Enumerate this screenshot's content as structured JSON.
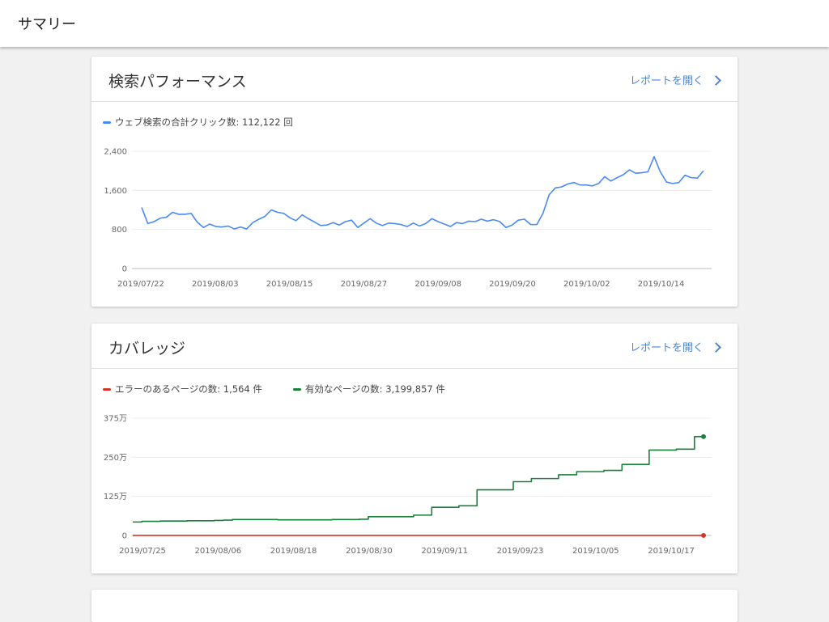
{
  "page": {
    "title": "サマリー"
  },
  "performance": {
    "title": "検索パフォーマンス",
    "report_link": "レポートを開く",
    "legend": [
      {
        "label": "ウェブ検索の合計クリック数: 112,122 回",
        "color": "#4a8af4"
      }
    ]
  },
  "coverage": {
    "title": "カバレッジ",
    "report_link": "レポートを開く",
    "legend": [
      {
        "label": "エラーのあるページの数: 1,564 件",
        "color": "#d93025"
      },
      {
        "label": "有効なページの数: 3,199,857 件",
        "color": "#188038"
      }
    ]
  },
  "chart_data": [
    {
      "type": "line",
      "ylim": [
        0,
        2400
      ],
      "yticks": [
        0,
        800,
        1600,
        2400
      ],
      "ytick_labels": [
        "0",
        "800",
        "1,600",
        "2,400"
      ],
      "xtick_labels": [
        "2019/07/22",
        "2019/08/03",
        "2019/08/15",
        "2019/08/27",
        "2019/09/08",
        "2019/09/20",
        "2019/10/02",
        "2019/10/14"
      ],
      "x_start": "2019/07/22",
      "series": [
        {
          "color": "#4a8af4",
          "values": [
            1250,
            920,
            960,
            1030,
            1050,
            1150,
            1110,
            1110,
            1130,
            950,
            840,
            910,
            860,
            850,
            870,
            810,
            850,
            810,
            940,
            1010,
            1070,
            1200,
            1150,
            1130,
            1040,
            980,
            1100,
            1020,
            950,
            880,
            890,
            940,
            890,
            960,
            990,
            840,
            930,
            1020,
            930,
            880,
            930,
            920,
            900,
            860,
            930,
            870,
            920,
            1020,
            960,
            910,
            860,
            940,
            920,
            970,
            960,
            1010,
            970,
            1000,
            960,
            840,
            890,
            990,
            1010,
            900,
            900,
            1130,
            1510,
            1650,
            1670,
            1730,
            1760,
            1710,
            1710,
            1690,
            1740,
            1880,
            1790,
            1860,
            1920,
            2020,
            1950,
            1960,
            1980,
            2290,
            1980,
            1770,
            1740,
            1760,
            1910,
            1860,
            1850,
            2000
          ]
        }
      ]
    },
    {
      "type": "line",
      "ylim": [
        0,
        3750000
      ],
      "yticks": [
        0,
        1250000,
        2500000,
        3750000
      ],
      "ytick_labels": [
        "0",
        "125万",
        "250万",
        "375万"
      ],
      "xtick_labels": [
        "2019/07/25",
        "2019/08/06",
        "2019/08/18",
        "2019/08/30",
        "2019/09/11",
        "2019/09/23",
        "2019/10/05",
        "2019/10/17"
      ],
      "x_start": "2019/07/25",
      "series": [
        {
          "color": "#188038",
          "step": true,
          "values": [
            430000,
            450000,
            450000,
            460000,
            460000,
            460000,
            470000,
            470000,
            470000,
            480000,
            490000,
            510000,
            510000,
            510000,
            510000,
            510000,
            500000,
            500000,
            500000,
            500000,
            500000,
            500000,
            510000,
            510000,
            510000,
            520000,
            600000,
            600000,
            600000,
            600000,
            600000,
            650000,
            650000,
            900000,
            900000,
            900000,
            950000,
            950000,
            1460000,
            1460000,
            1460000,
            1460000,
            1720000,
            1720000,
            1820000,
            1820000,
            1820000,
            1940000,
            1940000,
            2040000,
            2040000,
            2040000,
            2080000,
            2080000,
            2270000,
            2270000,
            2270000,
            2730000,
            2730000,
            2730000,
            2760000,
            2760000,
            3160000,
            3160000
          ]
        },
        {
          "color": "#d93025",
          "values": [
            1564,
            1564,
            1564,
            1564,
            1564,
            1564,
            1564,
            1564,
            1564,
            1564,
            1564,
            1564,
            1564,
            1564,
            1564,
            1564,
            1564,
            1564,
            1564,
            1564,
            1564,
            1564,
            1564,
            1564,
            1564,
            1564,
            1564,
            1564,
            1564,
            1564,
            1564,
            1564,
            1564,
            1564,
            1564,
            1564,
            1564,
            1564,
            1564,
            1564,
            1564,
            1564,
            1564,
            1564,
            1564,
            1564,
            1564,
            1564,
            1564,
            1564,
            1564,
            1564,
            1564,
            1564,
            1564,
            1564,
            1564,
            1564,
            1564,
            1564,
            1564,
            1564,
            1564,
            1564
          ]
        }
      ]
    }
  ]
}
